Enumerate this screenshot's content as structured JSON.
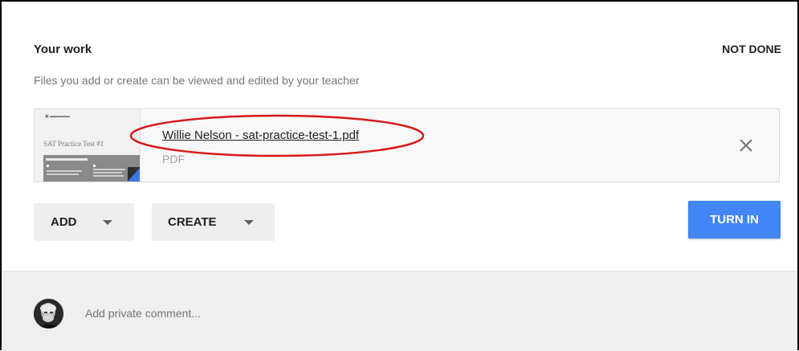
{
  "work": {
    "title": "Your work",
    "status": "NOT DONE",
    "subtitle": "Files you add or create can be viewed and edited by your teacher"
  },
  "attachment": {
    "file_name": "Willie Nelson - sat-practice-test-1.pdf",
    "file_type": "PDF",
    "thumbnail_text": "SAT Practice Test #1",
    "remove_icon": "close-icon"
  },
  "actions": {
    "add_label": "ADD",
    "create_label": "CREATE",
    "turn_in_label": "TURN IN"
  },
  "comment": {
    "placeholder": "Add private comment..."
  },
  "colors": {
    "accent": "#4285f4",
    "annotation": "#d81818"
  }
}
